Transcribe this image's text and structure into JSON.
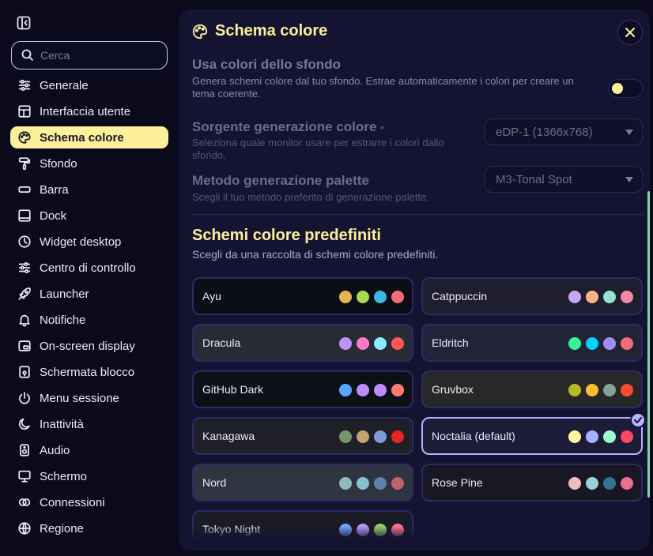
{
  "sidebar": {
    "search_placeholder": "Cerca",
    "items": [
      {
        "label": "Generale",
        "icon": "sliders-icon"
      },
      {
        "label": "Interfaccia utente",
        "icon": "layout-icon"
      },
      {
        "label": "Schema colore",
        "icon": "palette-icon",
        "active": true
      },
      {
        "label": "Sfondo",
        "icon": "paint-roller-icon"
      },
      {
        "label": "Barra",
        "icon": "bar-icon"
      },
      {
        "label": "Dock",
        "icon": "dock-icon"
      },
      {
        "label": "Widget desktop",
        "icon": "clock-icon"
      },
      {
        "label": "Centro di controllo",
        "icon": "adjustments-icon"
      },
      {
        "label": "Launcher",
        "icon": "rocket-icon"
      },
      {
        "label": "Notifiche",
        "icon": "bell-icon"
      },
      {
        "label": "On-screen display",
        "icon": "osd-icon"
      },
      {
        "label": "Schermata blocco",
        "icon": "lock-icon"
      },
      {
        "label": "Menu sessione",
        "icon": "power-icon"
      },
      {
        "label": "Inattività",
        "icon": "moon-icon"
      },
      {
        "label": "Audio",
        "icon": "speaker-icon"
      },
      {
        "label": "Schermo",
        "icon": "monitor-icon"
      },
      {
        "label": "Connessioni",
        "icon": "link-icon"
      },
      {
        "label": "Regione",
        "icon": "globe-icon"
      }
    ]
  },
  "panel": {
    "title": "Schema colore",
    "settings": {
      "wallpaper_colors": {
        "title": "Usa colori dello sfondo",
        "desc": "Genera schemi colore dal tuo sfondo. Estrae automaticamente i colori per creare un tema coerente.",
        "enabled": true
      },
      "source": {
        "title": "Sorgente generazione colore",
        "marker": "•",
        "desc": "Seleziona quale monitor usare per estrarre i colori dallo sfondo.",
        "value": "eDP-1 (1366x768)"
      },
      "palette_method": {
        "title": "Metodo generazione palette",
        "desc": "Scegli il tuo metodo preferito di generazione palette.",
        "value": "M3-Tonal Spot"
      }
    },
    "predefined": {
      "title": "Schemi colore predefiniti",
      "subtitle": "Scegli da una raccolta di schemi colore predefiniti.",
      "schemes": [
        {
          "name": "Ayu",
          "bg": "#0b0e14",
          "colors": [
            "#e6b450",
            "#aad94c",
            "#39bae6",
            "#f26d78"
          ]
        },
        {
          "name": "Catppuccin",
          "bg": "#1e1e2e",
          "colors": [
            "#cba6f7",
            "#fab387",
            "#94e2d5",
            "#f38ba8"
          ]
        },
        {
          "name": "Dracula",
          "bg": "#282a36",
          "colors": [
            "#bd93f9",
            "#ff79c6",
            "#8be9fd",
            "#ff5555"
          ]
        },
        {
          "name": "Eldritch",
          "bg": "#212337",
          "colors": [
            "#37f499",
            "#04d1f9",
            "#a48cf2",
            "#f16c75"
          ]
        },
        {
          "name": "GitHub Dark",
          "bg": "#0d1117",
          "colors": [
            "#58a6ff",
            "#bc8cff",
            "#bc8cff",
            "#ff7b72"
          ]
        },
        {
          "name": "Gruvbox",
          "bg": "#282828",
          "colors": [
            "#b8bb26",
            "#fabd2f",
            "#83a598",
            "#fb4934"
          ]
        },
        {
          "name": "Kanagawa",
          "bg": "#1f1f28",
          "colors": [
            "#76946a",
            "#c0a36e",
            "#7e9cd8",
            "#e82424"
          ]
        },
        {
          "name": "Noctalia (default)",
          "bg": "#1c1b38",
          "colors": [
            "#fff59b",
            "#a9aefe",
            "#9bfece",
            "#fd4663"
          ],
          "selected": true
        },
        {
          "name": "Nord",
          "bg": "#2e3440",
          "colors": [
            "#8fbcbb",
            "#88c0d0",
            "#5e81ac",
            "#bf616a"
          ]
        },
        {
          "name": "Rose Pine",
          "bg": "#191724",
          "colors": [
            "#ebbcba",
            "#9ccfd8",
            "#31748f",
            "#eb6f92"
          ]
        },
        {
          "name": "Tokyo Night",
          "bg": "#1a1b26",
          "colors": [
            "#7aa2f7",
            "#bb9af7",
            "#9ece6a",
            "#f7768e"
          ]
        }
      ]
    }
  },
  "colors": {
    "accent": "#fcf09a",
    "selection": "#b4b3ff",
    "scrollbar": "#7fd6a8"
  }
}
